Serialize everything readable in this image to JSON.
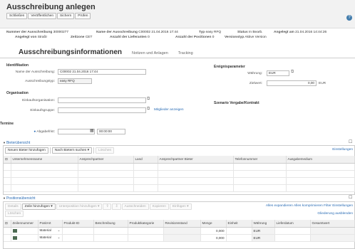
{
  "header": {
    "title": "Ausschreibung anlegen",
    "toolbar": [
      "Schließen",
      "Veröffentlichen",
      "Sichern",
      "Prüfen"
    ],
    "help_icon": "help-icon"
  },
  "meta": {
    "nr_label": "Nummer der Ausschreibung",
    "nr_value": "30000277",
    "name_label": "Name der Ausschreibung",
    "name_value": "C00002 21.04.2016 17:44",
    "typ_label": "Typ",
    "typ_value": "easy RFQ",
    "status_label": "Status",
    "status_value": "In Bearb.",
    "angelegt_am_label": "Angelegt am",
    "angelegt_am_value": "21.04.2016 14:44:26",
    "angelegt_von_label": "Angelegt von",
    "angelegt_von_value": "Straßr",
    "zeitzone_label": "Zeitzone",
    "zeitzone_value": "CET",
    "lieferanten_label": "Anzahl der Lieferanten",
    "lieferanten_value": "0",
    "positionen_label": "Anzahl der Positionen",
    "positionen_value": "0",
    "versionstyp_label": "Versionstyp",
    "versionstyp_value": "Aktive Version"
  },
  "tabs": [
    "Ausschreibungsinformationen",
    "Notizen und Anlagen",
    "Tracking"
  ],
  "ident": {
    "section": "Identifikation",
    "name_label": "Name der Ausschreibung:",
    "name_value": "C00002 21.04.2016 17:44",
    "typ_label": "Ausschreibungstyp:",
    "typ_value": "easy RFQ"
  },
  "orga": {
    "section": "Organisation",
    "einkaufsorg_label": "Einkaufsorganisation:",
    "einkaufsgruppe_label": "Einkaufsgruppe:",
    "mitglieder_link": "Mitglieder anzeigen"
  },
  "termine": {
    "section": "Termine",
    "abgabefrist_label": "Abgabefrist:",
    "abgabefrist_time": "00:00:00"
  },
  "ereignis": {
    "section": "Ereignisparameter",
    "waehrung_label": "Währung:",
    "waehrung_value": "EUR",
    "zielwert_label": "Zielwert:",
    "zielwert_value": "0,00",
    "zielwert_unit": "EUR"
  },
  "szenario": {
    "section": "Szenario Vergabe/Kontrakt"
  },
  "bieter": {
    "title": "Bieterübersicht",
    "buttons": [
      "Neuen Bieter hinzufügen",
      "Nach Bietern suchen",
      "Löschen"
    ],
    "settings_link": "Einstellungen",
    "columns": [
      "Unternehmensname",
      "Ansprechpartner",
      "Land",
      "Ansprechpartner Bieter",
      "Telefonnummer",
      "Ausgabemedium"
    ]
  },
  "positionen": {
    "title": "Positionsübersicht",
    "buttons": [
      "Details",
      "Zeile hinzufügen",
      "Unterposition hinzufügen",
      "Ausschneiden",
      "Kopieren",
      "Einfügen",
      "Löschen"
    ],
    "expand_link": "Alles expandieren",
    "collapse_link": "Alles komprimieren",
    "filter_link": "Filter",
    "settings_link": "Einstellungen",
    "structure_link": "Gliederung ausblenden",
    "columns": [
      "Zeilennummer",
      "PositArt",
      "Produkt-ID",
      "Beschreibung",
      "Produktkategorie",
      "Revisionsstand",
      "Menge",
      "Einheit",
      "Währung",
      "Lieferdatum",
      "Gesamtwert"
    ],
    "rows": [
      {
        "art": "Material",
        "menge": "0,000",
        "waehrung": "EUR"
      },
      {
        "art": "Material",
        "menge": "0,000",
        "waehrung": "EUR"
      }
    ]
  }
}
